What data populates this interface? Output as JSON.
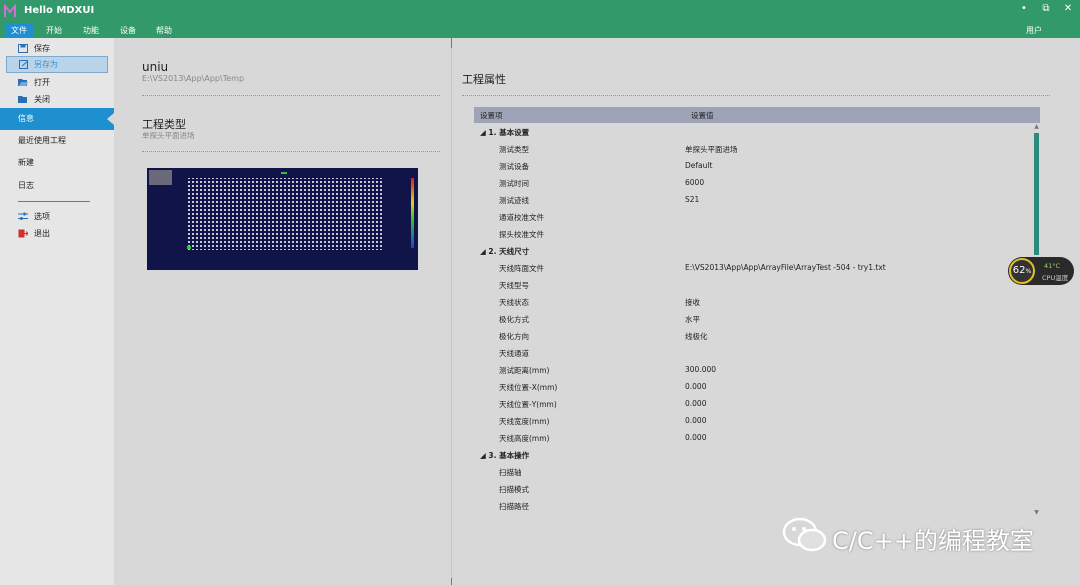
{
  "titlebar": {
    "title": "Hello MDXUI",
    "min": "•",
    "restore": "⧉",
    "close": "✕"
  },
  "menubar": {
    "items": [
      "文件",
      "开始",
      "功能",
      "设备",
      "帮助"
    ],
    "user": "用户"
  },
  "sidebar": {
    "file_items": [
      {
        "label": "保存",
        "icon": "save-icon"
      },
      {
        "label": "另存为",
        "icon": "save-as-icon"
      },
      {
        "label": "打开",
        "icon": "folder-open-icon"
      },
      {
        "label": "关闭",
        "icon": "folder-close-icon"
      }
    ],
    "nav": [
      {
        "label": "信息",
        "active": true
      },
      {
        "label": "最近使用工程"
      },
      {
        "label": "新建"
      },
      {
        "label": "日志"
      }
    ],
    "bottom_items": [
      {
        "label": "选项",
        "icon": "settings-icon"
      },
      {
        "label": "退出",
        "icon": "exit-icon"
      }
    ]
  },
  "project": {
    "name": "uniu",
    "path": "E:\\VS2013\\App\\App\\Temp",
    "type_title": "工程类型",
    "type_sub": "单探头平面进场"
  },
  "properties": {
    "title": "工程属性",
    "col_key": "设置项",
    "col_value": "设置值",
    "groups": [
      {
        "name": "1. 基本设置",
        "rows": [
          {
            "k": "测试类型",
            "v": "单探头平面进场"
          },
          {
            "k": "测试设备",
            "v": "Default"
          },
          {
            "k": "测试时间",
            "v": "6000"
          },
          {
            "k": "测试迹线",
            "v": "S21"
          },
          {
            "k": "通道校准文件",
            "v": ""
          },
          {
            "k": "探头校准文件",
            "v": ""
          }
        ]
      },
      {
        "name": "2. 天线尺寸",
        "rows": [
          {
            "k": "天线阵面文件",
            "v": "E:\\VS2013\\App\\App\\ArrayFile\\ArrayTest -504 - try1.txt"
          },
          {
            "k": "天线型号",
            "v": ""
          },
          {
            "k": "天线状态",
            "v": "接收"
          },
          {
            "k": "极化方式",
            "v": "水平"
          },
          {
            "k": "极化方向",
            "v": "线极化"
          },
          {
            "k": "天线通道",
            "v": ""
          },
          {
            "k": "测试距离(mm)",
            "v": "300.000"
          },
          {
            "k": "天线位置-X(mm)",
            "v": "0.000"
          },
          {
            "k": "天线位置-Y(mm)",
            "v": "0.000"
          },
          {
            "k": "天线宽度(mm)",
            "v": "0.000"
          },
          {
            "k": "天线高度(mm)",
            "v": "0.000"
          }
        ]
      },
      {
        "name": "3. 基本操作",
        "rows": [
          {
            "k": "扫描轴",
            "v": ""
          },
          {
            "k": "扫描模式",
            "v": ""
          },
          {
            "k": "扫描路径",
            "v": ""
          }
        ]
      }
    ]
  },
  "cpu": {
    "percent": "62",
    "unit": "%",
    "temp": "41°C",
    "label": "CPU温度"
  },
  "watermark": {
    "text": "C/C++的编程教室"
  },
  "colors": {
    "accent": "#1e90d0",
    "titlebar": "#329a6a",
    "panel": "#d8d8d8",
    "sidebar": "#e6e6e6",
    "grid_header": "#9fa3b8"
  }
}
